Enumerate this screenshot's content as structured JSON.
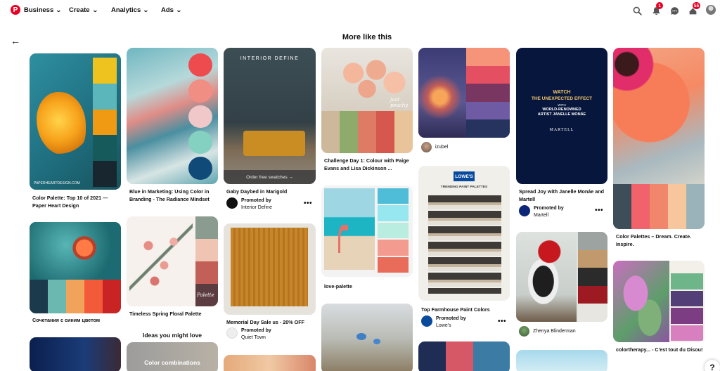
{
  "nav": {
    "logo_letter": "P",
    "business": "Business",
    "create": "Create",
    "analytics": "Analytics",
    "ads": "Ads",
    "notif_badge": "1",
    "updates_badge": "55"
  },
  "page": {
    "title": "More like this",
    "ideas_heading": "Ideas you might love"
  },
  "pins": {
    "p1": {
      "caption": "Color Palette: Top 10 of 2021 — Paper Heart Design",
      "watermark": "PAPERHEARTDESIGN.COM"
    },
    "p2": {
      "caption": "Сочетания с синим цветом"
    },
    "p3": {
      "caption": "Blue in Marketing: Using Color in Branding - The Radiance Mindset"
    },
    "p4": {
      "caption": "Timeless Spring Floral Palette",
      "badge": "Palette"
    },
    "p5": {
      "caption": "Color combinations"
    },
    "p6": {
      "caption": "Gaby Daybed in Marigold",
      "overlay": "INTERIOR DEFINE",
      "cta": "Order free swatches →",
      "promoted": "Promoted by",
      "advertiser": "Interior Define"
    },
    "p7": {
      "caption": "Memorial Day Sale us - 20% OFF",
      "promoted": "Promoted by",
      "advertiser": "Quiet Town"
    },
    "p8": {
      "caption": "Challenge Day 1: Colour with Paige Evans and Lisa Dickinson ...",
      "overlay": "just peachy"
    },
    "p9": {
      "caption": "love-palette"
    },
    "p10": {
      "user": "izubel"
    },
    "p11": {
      "caption": "Top Farmhouse Paint Colors",
      "brand": "LOWE'S",
      "header": "TRENDING PAINT PALETTES",
      "promoted": "Promoted by",
      "advertiser": "Lowe's"
    },
    "p12": {
      "caption": "Spread Joy with Janelle Monáe and Martell",
      "line1": "WATCH",
      "line2": "THE UNEXPECTED EFFECT",
      "line3": "WITH",
      "line4": "WORLD-RENOWNED",
      "line5": "ARTIST JANELLE MONÁE",
      "brand": "MARTELL",
      "promoted": "Promoted by",
      "advertiser": "Martell"
    },
    "p13": {
      "user": "Zhenya Blinderman"
    },
    "p14": {
      "caption": "Color Palettes – Dream. Create. Inspire."
    },
    "p15": {
      "caption": "colortherapy... - C'est tout du Disou!"
    }
  },
  "colors": {
    "brand_red": "#e60023"
  }
}
